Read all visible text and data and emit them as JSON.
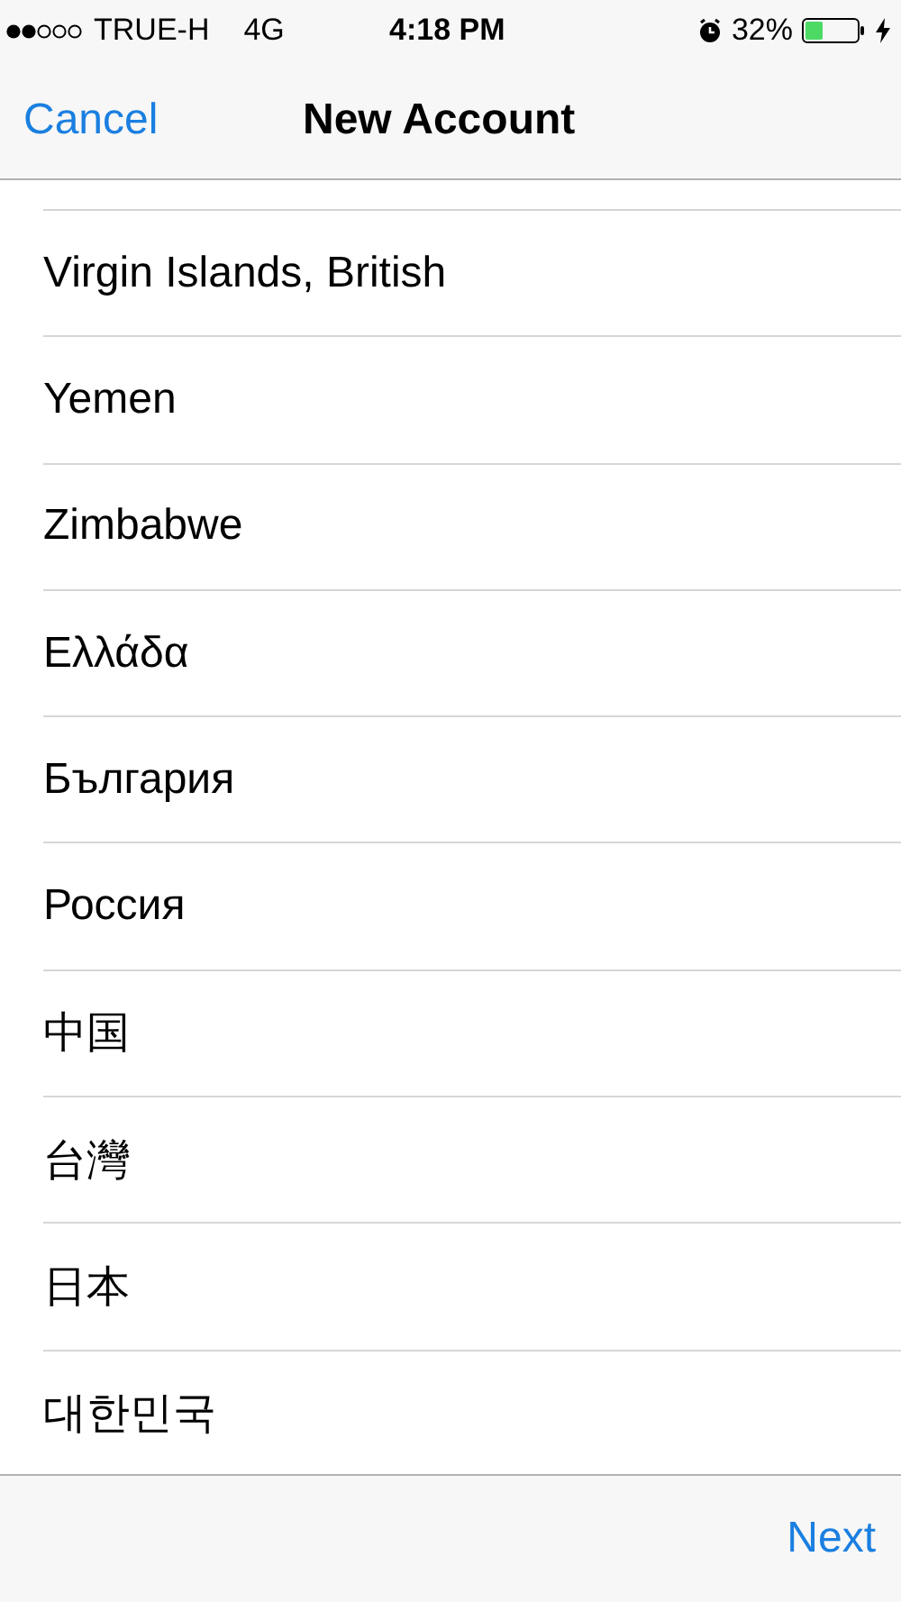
{
  "status_bar": {
    "carrier": "TRUE-H",
    "network": "4G",
    "time": "4:18 PM",
    "battery": "32%"
  },
  "nav_bar": {
    "left_button": "Cancel",
    "title": "New Account"
  },
  "countries": [
    "Virgin Islands, British",
    "Yemen",
    "Zimbabwe",
    "Ελλάδα",
    "България",
    "Россия",
    "中国",
    "台灣",
    "日本",
    "대한민국"
  ],
  "toolbar": {
    "right_button": "Next"
  }
}
